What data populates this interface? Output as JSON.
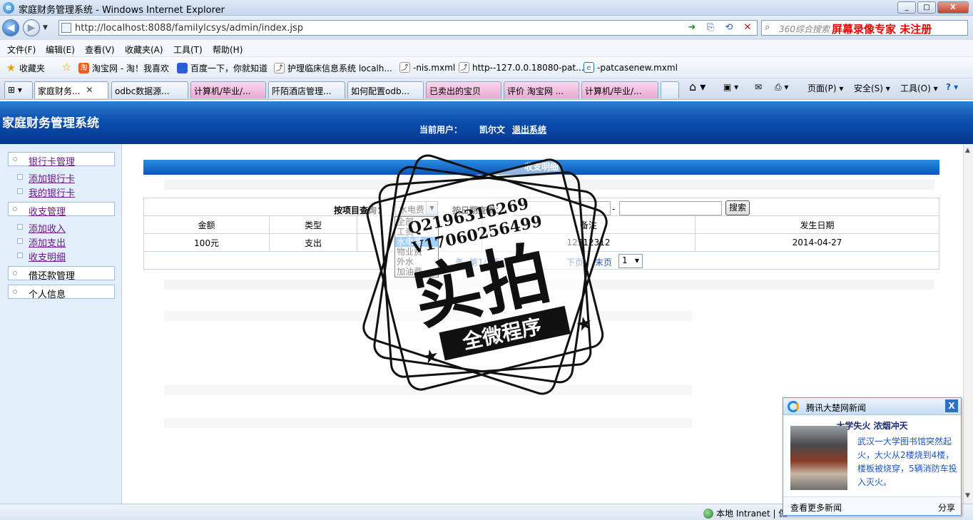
{
  "window": {
    "title": "家庭财务管理系统 - Windows Internet Explorer",
    "buttons": [
      "_",
      "□",
      "X"
    ]
  },
  "address_bar": {
    "url": "http://localhost:8088/familylcsys/admin/index.jsp",
    "search_placeholder": "360综合搜索",
    "overlay_text": "屏幕录像专家 未注册"
  },
  "menu": [
    "文件(F)",
    "编辑(E)",
    "查看(V)",
    "收藏夹(A)",
    "工具(T)",
    "帮助(H)"
  ],
  "favorites": {
    "label": "收藏夹",
    "items": [
      "淘宝网 - 淘！我喜欢",
      "百度一下，你就知道",
      "护理临床信息系统 localh...",
      "-nis.mxml",
      "http--127.0.0.18080-pat...",
      "-patcasenew.mxml"
    ]
  },
  "tabs": [
    "家庭财务...",
    "odbc数据源...",
    "计算机/毕业/...",
    "阡陌酒店管理...",
    "如何配置odb...",
    "已卖出的宝贝",
    "评价 淘宝网 ...",
    "计算机/毕业/..."
  ],
  "command_bar": {
    "page": "页面(P)",
    "safety": "安全(S)",
    "tools": "工具(O)"
  },
  "app": {
    "title": "家庭财务管理系统",
    "current_user_label": "当前用户：",
    "username": "凯尔文",
    "logout": "退出系统"
  },
  "sidebar": {
    "groups": [
      {
        "label": "银行卡管理",
        "items": [
          "添加银行卡",
          "我的银行卡"
        ]
      },
      {
        "label": "收支管理",
        "items": [
          "添加收入",
          "添加支出",
          "收支明细"
        ]
      },
      {
        "label": "借还款管理",
        "items": []
      },
      {
        "label": "个人信息",
        "items": []
      }
    ]
  },
  "panel": {
    "title": "收支明细",
    "filter": {
      "by_item_label": "按项目查询：",
      "item_value": "水电费",
      "by_date_label": "按日期查询：",
      "date_separator": "-",
      "search_button": "搜索"
    },
    "dropdown_options": [
      "全部",
      "工资",
      "水电费",
      "物业费",
      "外水",
      "加油费"
    ],
    "dropdown_selected": 2,
    "columns": [
      "金额",
      "类型",
      "",
      "备注",
      "发生日期"
    ],
    "rows": [
      {
        "amount": "100元",
        "type": "支出",
        "item": "",
        "note": "12312312",
        "date": "2014-04-27"
      }
    ],
    "pager": {
      "records": "条",
      "page_info": "第1/1页",
      "next": "下页",
      "last": "末页",
      "page_select": "1"
    }
  },
  "stamp": {
    "main": "实拍",
    "banner": "全微程序",
    "line1": "Q2196316269",
    "line2": "V17060256499"
  },
  "status_bar": {
    "zone": "本地 Intranet | 保"
  },
  "news_popup": {
    "title": "腾讯大楚网新闻",
    "headline": "大学失火 浓烟冲天",
    "body": "武汉一大学图书馆突然起火，大火从2楼烧到4楼，楼板被烧穿，5辆消防车投入灭火。",
    "more": "查看更多新闻",
    "share": "分享",
    "close": "X"
  }
}
